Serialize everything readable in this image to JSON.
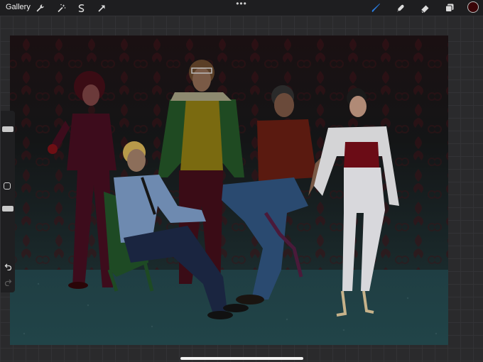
{
  "topbar": {
    "gallery_label": "Gallery",
    "tools_left": [
      "wrench-icon",
      "magic-wand-icon",
      "selection-icon",
      "transform-arrow-icon"
    ],
    "more_label": "•••",
    "tools_right": [
      "brush-icon",
      "smudge-icon",
      "eraser-icon",
      "layers-icon"
    ],
    "active_color": "#3a0508",
    "active_tool_color": "#2a7de1"
  },
  "sidebar": {
    "size_slider_level": 0.2,
    "opacity_slider_level": 0.2,
    "undo_icon": "undo-icon",
    "redo_icon": "redo-icon"
  }
}
